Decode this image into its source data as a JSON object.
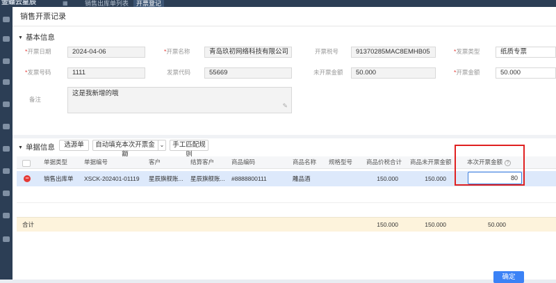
{
  "app": {
    "logo": "金蝶云星辰"
  },
  "tabs": [
    {
      "label": "销售出库单列表"
    },
    {
      "label": "开票登记"
    }
  ],
  "dialog": {
    "title": "销售开票记录",
    "confirm_label": "确定"
  },
  "basic": {
    "section_title": "基本信息",
    "fields": {
      "invoice_date": {
        "label": "开票日期",
        "value": "2024-04-06"
      },
      "invoice_name": {
        "label": "开票名称",
        "value": "青岛玖初网络科技有限公司"
      },
      "tax_no": {
        "label": "开票税号",
        "value": "91370285MAC8EMHB05"
      },
      "invoice_type": {
        "label": "发票类型",
        "value": "纸质专票"
      },
      "invoice_number": {
        "label": "发票号码",
        "value": "1111"
      },
      "invoice_code": {
        "label": "发票代码",
        "value": "55669"
      },
      "uninvoiced_amount": {
        "label": "未开票金额",
        "value": "50.000"
      },
      "invoice_amount": {
        "label": "开票金额",
        "value": "50.000"
      },
      "remark": {
        "label": "备注",
        "value": "这是我新增的哦"
      }
    }
  },
  "detail": {
    "section_title": "单据信息",
    "buttons": {
      "select_doc": "选源单",
      "auto_fill": "自动填充本次开票金额",
      "manual_match": "手工匹配规则"
    },
    "columns": {
      "doc_type": "单据类型",
      "doc_no": "单据编号",
      "customer": "客户",
      "settle_customer": "结算客户",
      "product_code": "商品编码",
      "product_name": "商品名称",
      "spec": "规格型号",
      "tax_total": "商品价税合计",
      "uninvoiced": "商品未开票金额",
      "this_invoice": "本次开票金额"
    },
    "rows": [
      {
        "doc_type": "销售出库单",
        "doc_no": "XSCK-202401-01119",
        "customer": "星辰旗舰账...",
        "settle_customer": "星辰旗舰账...",
        "product_code": "#8888800111",
        "product_name": "雕品酒",
        "spec": "",
        "tax_total": "150.000",
        "uninvoiced": "150.000",
        "this_invoice": "80"
      }
    ],
    "totals": {
      "label": "合计",
      "tax_total": "150.000",
      "uninvoiced": "150.000",
      "this_invoice": "50.000"
    }
  },
  "colors": {
    "accent": "#3b82f6",
    "required": "#e53935",
    "highlight_box": "#e02020",
    "selected_row": "#dde9fb",
    "total_row": "#fdf3dc"
  }
}
